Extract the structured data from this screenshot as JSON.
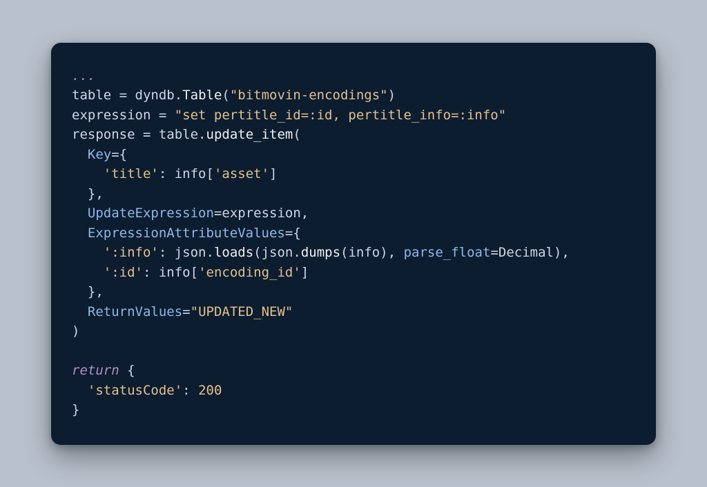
{
  "code": {
    "ellipsis": "...",
    "l1": {
      "table": "table",
      "eq": " = ",
      "dyndb": "dyndb",
      "dot": ".",
      "Table": "Table",
      "lp": "(",
      "str": "\"bitmovin-encodings\"",
      "rp": ")"
    },
    "l2": {
      "expr": "expression",
      "eq": " = ",
      "str": "\"set pertitle_id=:id, pertitle_info=:info\""
    },
    "l3": {
      "resp": "response",
      "eq": " = ",
      "table": "table",
      "dot": ".",
      "upd": "update_item",
      "lp": "("
    },
    "l4": {
      "Key": "Key",
      "eqbr": "={"
    },
    "l5": {
      "ktitle": "'title'",
      "colon": ": ",
      "info": "info",
      "lb": "[",
      "asset": "'asset'",
      "rb": "]"
    },
    "l6": {
      "close": "},"
    },
    "l7": {
      "UE": "UpdateExpression",
      "eq": "=",
      "expr": "expression",
      "comma": ","
    },
    "l8": {
      "EAV": "ExpressionAttributeValues",
      "eqbr": "={"
    },
    "l9": {
      "kinfo": "':info'",
      "colon": ": ",
      "json1": "json",
      "dot1": ".",
      "loads": "loads",
      "lp1": "(",
      "json2": "json",
      "dot2": ".",
      "dumps": "dumps",
      "lp2": "(",
      "info": "info",
      "rp2": ")",
      "comma1": ", ",
      "pf": "parse_float",
      "eq": "=",
      "Decimal": "Decimal",
      "rp1": ")",
      "comma2": ","
    },
    "l10": {
      "kid": "':id'",
      "colon": ": ",
      "info": "info",
      "lb": "[",
      "enc": "'encoding_id'",
      "rb": "]"
    },
    "l11": {
      "close": "},"
    },
    "l12": {
      "RV": "ReturnValues",
      "eq": "=",
      "str": "\"UPDATED_NEW\""
    },
    "l13": {
      "rp": ")"
    },
    "l14": {
      "ret": "return",
      "sp": " ",
      "br": "{"
    },
    "l15": {
      "k": "'statusCode'",
      "colon": ": ",
      "num": "200"
    },
    "l16": {
      "br": "}"
    }
  }
}
